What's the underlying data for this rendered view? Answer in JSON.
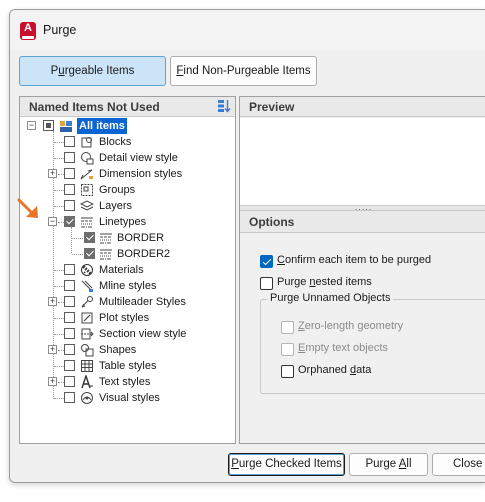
{
  "window": {
    "title": "Purge",
    "app_icon": "autocad-icon"
  },
  "tabs": [
    {
      "label": "Purgeable Items",
      "underline_index": 1,
      "active": true
    },
    {
      "label": "Find Non-Purgeable Items",
      "underline_index": 0,
      "active": false
    }
  ],
  "left_panel": {
    "header": "Named Items Not Used"
  },
  "tree": {
    "root_label": "All items",
    "items": [
      {
        "label": "Blocks",
        "icon": "blocks-icon"
      },
      {
        "label": "Detail view style",
        "icon": "detail-view-style-icon"
      },
      {
        "label": "Dimension styles",
        "icon": "dimension-styles-icon"
      },
      {
        "label": "Groups",
        "icon": "groups-icon"
      },
      {
        "label": "Layers",
        "icon": "layers-icon"
      },
      {
        "label": "Linetypes",
        "icon": "linetypes-icon"
      },
      {
        "label": "BORDER",
        "icon": "linetype-icon"
      },
      {
        "label": "BORDER2",
        "icon": "linetype-icon"
      },
      {
        "label": "Materials",
        "icon": "materials-icon"
      },
      {
        "label": "Mline styles",
        "icon": "mline-styles-icon"
      },
      {
        "label": "Multileader Styles",
        "icon": "multileader-styles-icon"
      },
      {
        "label": "Plot styles",
        "icon": "plot-styles-icon"
      },
      {
        "label": "Section view style",
        "icon": "section-view-style-icon"
      },
      {
        "label": "Shapes",
        "icon": "shapes-icon"
      },
      {
        "label": "Table styles",
        "icon": "table-styles-icon"
      },
      {
        "label": "Text styles",
        "icon": "text-styles-icon"
      },
      {
        "label": "Visual styles",
        "icon": "visual-styles-icon"
      }
    ]
  },
  "right_panel": {
    "preview_header": "Preview",
    "options_header": "Options",
    "options": {
      "confirm_label": "Confirm each item to be purged",
      "confirm_checked": true,
      "nested_label": "Purge nested items",
      "nested_checked": false,
      "group_title": "Purge Unnamed Objects",
      "zero_length_label": "Zero-length geometry",
      "empty_text_label": "Empty text objects",
      "orphaned_label": "Orphaned data"
    }
  },
  "buttons": {
    "purge_checked": "Purge Checked Items",
    "purge_all": "Purge All",
    "close": "Close"
  },
  "colors": {
    "accent": "#0067c0",
    "selection": "#0a64d2",
    "arrow": "#e8742a",
    "active_tab": "#cce4f7"
  }
}
